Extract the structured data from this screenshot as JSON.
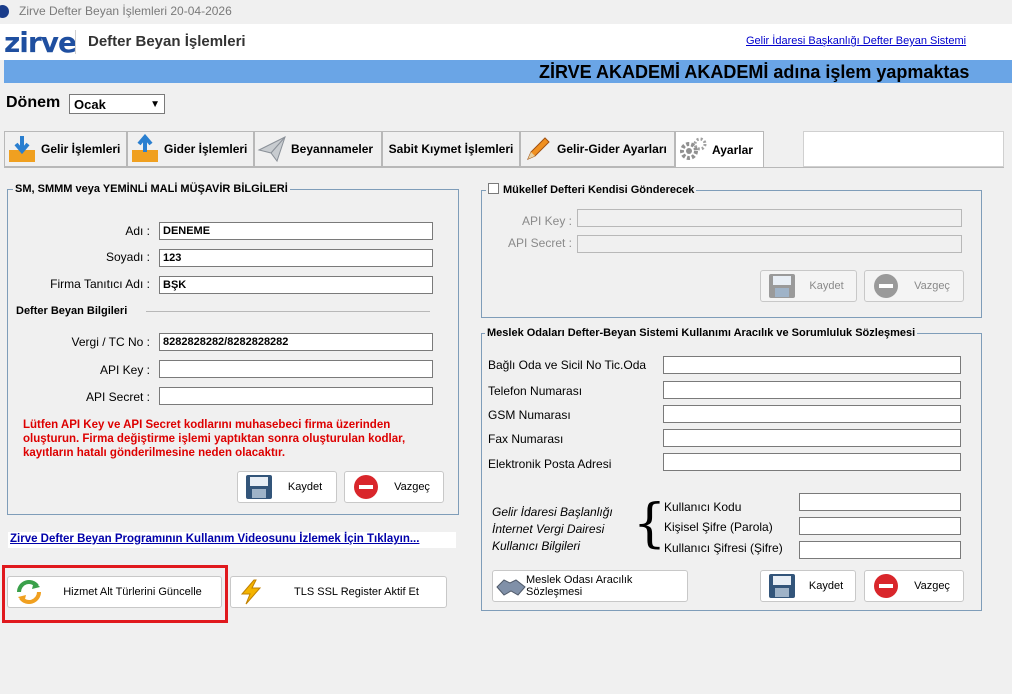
{
  "window": {
    "title": "Zirve Defter Beyan İşlemleri 20-04-2026"
  },
  "header": {
    "logo": "zirve",
    "title": "Defter Beyan İşlemleri",
    "link": "Gelir İdaresi Başkanlığı Defter Beyan Sistemi"
  },
  "banner": {
    "text": "ZİRVE AKADEMİ AKADEMİ adına işlem yapmaktas"
  },
  "donem": {
    "label": "Dönem",
    "value": "Ocak"
  },
  "tabs": [
    {
      "label": "Gelir İşlemleri"
    },
    {
      "label": "Gider İşlemleri"
    },
    {
      "label": "Beyannameler"
    },
    {
      "label": "Sabit Kıymet İşlemleri"
    },
    {
      "label": "Gelir-Gider Ayarları"
    },
    {
      "label": "Ayarlar"
    }
  ],
  "left_group": {
    "legend": "SM, SMMM veya YEMİNLİ MALİ MÜŞAVİR BİLGİLERİ",
    "adi_label": "Adı  :",
    "adi_value": "DENEME",
    "soyadi_label": "Soyadı :",
    "soyadi_value": "123",
    "firma_label": "Firma Tanıtıcı Adı :",
    "firma_value": "BŞK",
    "sub_heading": "Defter Beyan Bilgileri",
    "vergi_label": "Vergi / TC No :",
    "vergi_value": "8282828282/8282828282",
    "apikey_label": "API Key :",
    "apikey_value": "",
    "apisecret_label": "API Secret :",
    "apisecret_value": "",
    "warning": "Lütfen API Key ve API Secret kodlarını muhasebeci firma üzerinden oluşturun. Firma değiştirme işlemi yaptıktan sonra oluşturulan kodlar, kayıtların hatalı gönderilmesine neden olacaktır.",
    "save_label": "Kaydet",
    "cancel_label": "Vazgeç"
  },
  "mukellef_group": {
    "legend": "Mükellef Defteri Kendisi Gönderecek",
    "apikey_label": "API Key :",
    "apisecret_label": "API Secret :",
    "save_label": "Kaydet",
    "cancel_label": "Vazgeç"
  },
  "meslek_group": {
    "legend": "Meslek Odaları Defter-Beyan Sistemi Kullanımı Aracılık ve Sorumluluk Sözleşmesi",
    "fields": [
      {
        "label": "Bağlı Oda ve Sicil No Tic.Oda",
        "value": ""
      },
      {
        "label": "Telefon Numarası",
        "value": ""
      },
      {
        "label": "GSM Numarası",
        "value": ""
      },
      {
        "label": "Fax Numarası",
        "value": ""
      },
      {
        "label": "Elektronik Posta Adresi",
        "value": ""
      }
    ],
    "gib_lines": [
      "Gelir İdaresi Başlanlığı",
      "İnternet Vergi Dairesi",
      "Kullanıcı Bilgileri"
    ],
    "brace": "{",
    "user_fields": [
      {
        "label": "Kullanıcı Kodu",
        "value": ""
      },
      {
        "label": "Kişisel Şifre (Parola)",
        "value": ""
      },
      {
        "label": "Kullanıcı Şifresi (Şifre)",
        "value": ""
      }
    ],
    "contract_label": "Meslek Odası Aracılık Sözleşmesi",
    "save_label": "Kaydet",
    "cancel_label": "Vazgeç"
  },
  "video_link": "Zirve Defter Beyan Programının Kullanım Videosunu İzlemek İçin Tıklayın...",
  "bottom_buttons": {
    "update_label": "Hizmet Alt Türlerini Güncelle",
    "tls_label": "TLS SSL Register Aktif Et"
  },
  "colors": {
    "banner": "#6aa5e6",
    "highlight": "#e0191e",
    "warning": "#dd0000",
    "link": "#0000cc"
  }
}
